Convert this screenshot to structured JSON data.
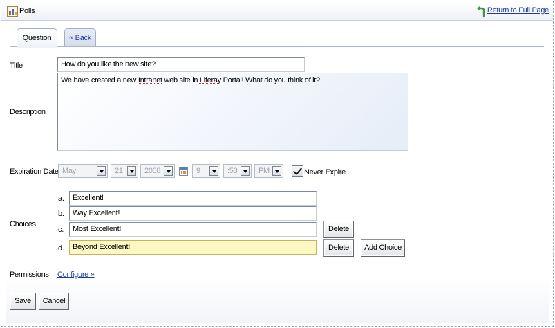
{
  "portlet": {
    "title": "Polls",
    "return_link": "Return to Full Page"
  },
  "tabs": [
    {
      "label": "Question",
      "selected": true
    },
    {
      "label": "« Back",
      "selected": false
    }
  ],
  "form": {
    "title_label": "Title",
    "title_value": "How do you like the new site?",
    "description_label": "Description",
    "description_value": {
      "before": "We have created a new ",
      "word1": "Intranet",
      "middle": " web site in ",
      "word2": "Liferay",
      "after": " Portal! What do you think of it?"
    },
    "expiration_label": "Expiration Date",
    "expiration": {
      "month": "May",
      "day": "21",
      "year": "2008",
      "hour": "9",
      "minute": ":53",
      "ampm": "PM"
    },
    "never_expire_label": "Never Expire",
    "never_expire_checked": true,
    "choices_label": "Choices",
    "choices": [
      {
        "letter": "a.",
        "value": "Excellent!"
      },
      {
        "letter": "b.",
        "value": "Way Excellent!"
      },
      {
        "letter": "c.",
        "value": "Most Excellent!"
      },
      {
        "letter": "d.",
        "value": "Beyond Excellent!"
      }
    ],
    "delete_label": "Delete",
    "add_choice_label": "Add Choice",
    "permissions_label": "Permissions",
    "configure_link": "Configure »"
  },
  "actions": {
    "save_label": "Save",
    "cancel_label": "Cancel"
  },
  "colors": {
    "link": "#1d3c94",
    "active_field": "#fcf8c4",
    "titlebar_border": "#c8d0dc"
  }
}
